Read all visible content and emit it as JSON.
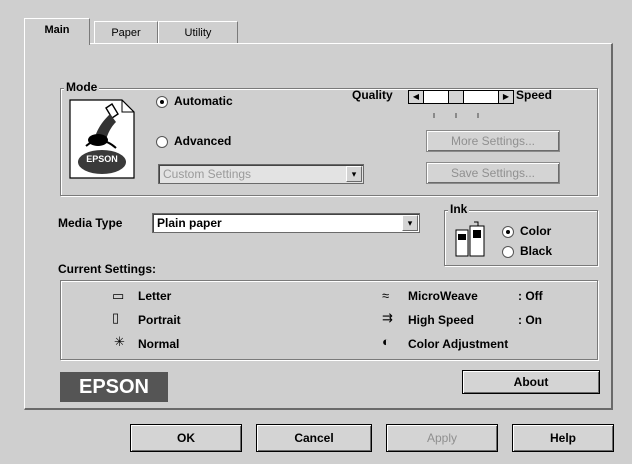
{
  "tabs": [
    {
      "label": "Main"
    },
    {
      "label": "Paper"
    },
    {
      "label": "Utility"
    }
  ],
  "mode": {
    "title": "Mode",
    "automatic_label": "Automatic",
    "advanced_label": "Advanced",
    "selected": "Automatic",
    "custom_settings_value": "Custom Settings",
    "logo_text": "EPSON",
    "quality_label": "Quality",
    "speed_label": "Speed",
    "slider_level": 0.4,
    "more_settings_label": "More Settings...",
    "save_settings_label": "Save Settings..."
  },
  "media": {
    "label": "Media Type",
    "value": "Plain paper"
  },
  "ink": {
    "title": "Ink",
    "color_label": "Color",
    "black_label": "Black",
    "selected": "Color"
  },
  "current_settings": {
    "title": "Current Settings:",
    "left": [
      {
        "icon": "paper-size-icon",
        "label": "Letter"
      },
      {
        "icon": "orientation-icon",
        "label": "Portrait"
      },
      {
        "icon": "quality-icon",
        "label": "Normal"
      }
    ],
    "right": [
      {
        "icon": "microweave-icon",
        "label": "MicroWeave",
        "value": ": Off"
      },
      {
        "icon": "high-speed-icon",
        "label": "High Speed",
        "value": ": On"
      },
      {
        "icon": "color-adjust-icon",
        "label": "Color Adjustment",
        "value": ""
      }
    ]
  },
  "brand": {
    "logo": "EPSON"
  },
  "about_label": "About",
  "footer": {
    "ok": "OK",
    "cancel": "Cancel",
    "apply": "Apply",
    "help": "Help"
  }
}
